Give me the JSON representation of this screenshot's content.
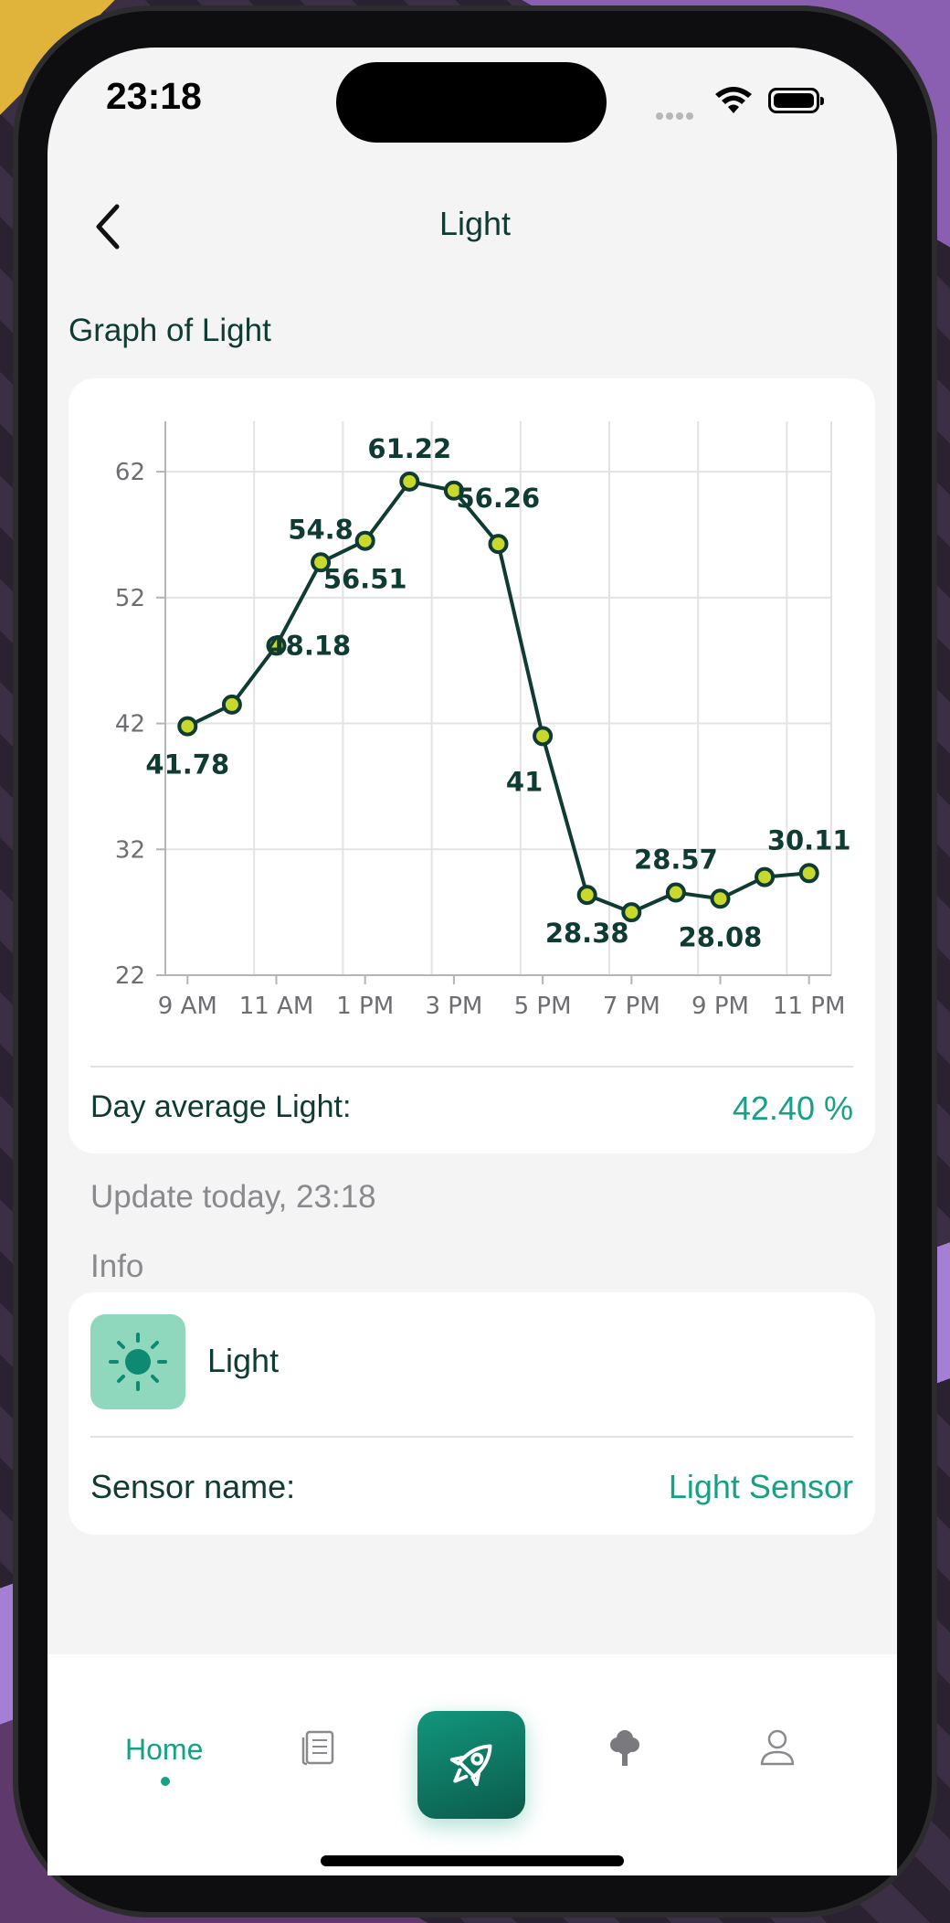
{
  "status_bar": {
    "time": "23:18"
  },
  "header": {
    "title": "Light"
  },
  "graph": {
    "section_title": "Graph of Light",
    "average_label": "Day average Light:",
    "average_value": "42.40 %"
  },
  "update_text": "Update today, 23:18",
  "info": {
    "label": "Info",
    "sensor_type": "Light",
    "sensor_name_label": "Sensor name:",
    "sensor_name_value": "Light Sensor",
    "icon": "sun-icon"
  },
  "nav": {
    "home_label": "Home",
    "items": [
      "home",
      "news-icon",
      "rocket-icon",
      "tree-icon",
      "user-icon"
    ]
  },
  "colors": {
    "accent": "#16a085",
    "line": "#0f3b32",
    "point_fill": "#c8d92b",
    "icon_tile": "#8fd8be"
  },
  "chart_data": {
    "type": "line",
    "x": [
      "9 AM",
      "10 AM",
      "11 AM",
      "12 PM",
      "1 PM",
      "2 PM",
      "3 PM",
      "4 PM",
      "5 PM",
      "6 PM",
      "7 PM",
      "8 PM",
      "9 PM",
      "10 PM",
      "11 PM"
    ],
    "xticks": [
      "9 AM",
      "11 AM",
      "1 PM",
      "3 PM",
      "5 PM",
      "7 PM",
      "9 PM",
      "11 PM"
    ],
    "values": [
      41.78,
      43.5,
      48.18,
      54.8,
      56.51,
      61.22,
      60.5,
      56.26,
      41,
      28.38,
      27,
      28.57,
      28.08,
      29.8,
      30.11
    ],
    "data_labels": [
      {
        "i": 0,
        "text": "41.78",
        "pos": "below"
      },
      {
        "i": 2,
        "text": "48.18",
        "pos": "left"
      },
      {
        "i": 3,
        "text": "54.8",
        "pos": "above"
      },
      {
        "i": 4,
        "text": "56.51",
        "pos": "below"
      },
      {
        "i": 5,
        "text": "61.22",
        "pos": "above"
      },
      {
        "i": 7,
        "text": "56.26",
        "pos": "above"
      },
      {
        "i": 8,
        "text": "41",
        "pos": "below"
      },
      {
        "i": 9,
        "text": "28.38",
        "pos": "below"
      },
      {
        "i": 11,
        "text": "28.57",
        "pos": "above"
      },
      {
        "i": 12,
        "text": "28.08",
        "pos": "below"
      },
      {
        "i": 14,
        "text": "30.11",
        "pos": "above"
      }
    ],
    "yticks": [
      62,
      52,
      42,
      32,
      22
    ],
    "ylim": [
      22,
      66
    ],
    "grid": true
  }
}
